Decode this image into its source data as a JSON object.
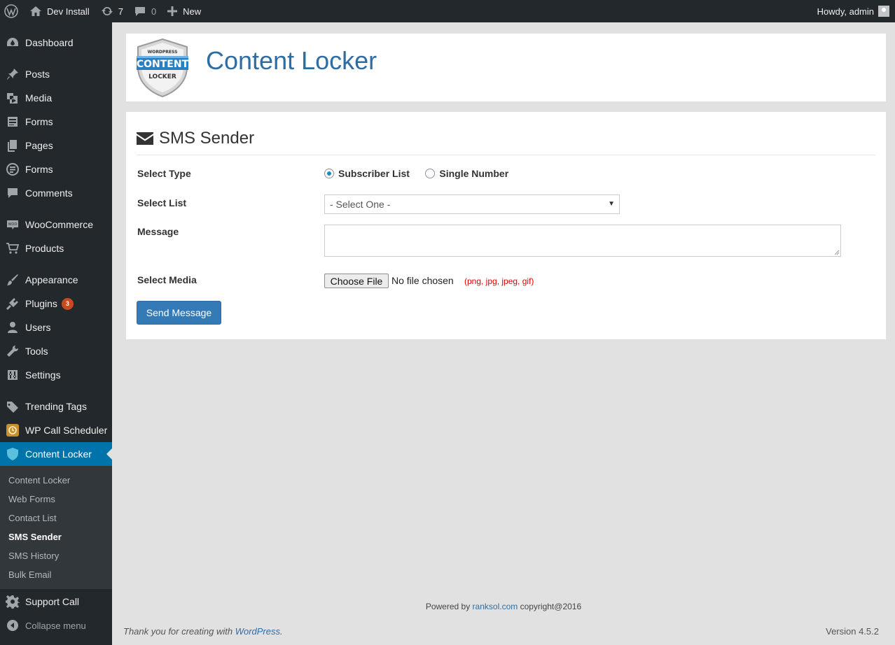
{
  "adminbar": {
    "site_name": "Dev Install",
    "updates_count": "7",
    "comments_count": "0",
    "new_label": "New",
    "greeting": "Howdy, admin"
  },
  "sidebar": {
    "items": [
      {
        "label": "Dashboard",
        "icon": "dashboard-icon"
      },
      {
        "label": "Posts",
        "icon": "pin-icon"
      },
      {
        "label": "Media",
        "icon": "media-icon"
      },
      {
        "label": "Forms",
        "icon": "forms-icon"
      },
      {
        "label": "Pages",
        "icon": "pages-icon"
      },
      {
        "label": "Forms",
        "icon": "forms-circle-icon"
      },
      {
        "label": "Comments",
        "icon": "comment-icon"
      },
      {
        "label": "WooCommerce",
        "icon": "woo-icon"
      },
      {
        "label": "Products",
        "icon": "cart-icon"
      },
      {
        "label": "Appearance",
        "icon": "brush-icon"
      },
      {
        "label": "Plugins",
        "icon": "plugin-icon",
        "badge": "3"
      },
      {
        "label": "Users",
        "icon": "user-icon"
      },
      {
        "label": "Tools",
        "icon": "wrench-icon"
      },
      {
        "label": "Settings",
        "icon": "settings-icon"
      },
      {
        "label": "Trending Tags",
        "icon": "tag-icon"
      },
      {
        "label": "WP Call Scheduler",
        "icon": "scheduler-icon"
      },
      {
        "label": "Content Locker",
        "icon": "shield-icon"
      }
    ],
    "submenu": [
      "Content Locker",
      "Web Forms",
      "Contact List",
      "SMS Sender",
      "SMS History",
      "Bulk Email"
    ],
    "support": "Support Call",
    "collapse": "Collapse menu"
  },
  "header": {
    "logo_top": "WORDPRESS",
    "logo_main": "CONTENT",
    "logo_bottom": "LOCKER",
    "title": "Content Locker"
  },
  "form": {
    "title": "SMS Sender",
    "type_label": "Select Type",
    "radio_subscriber": "Subscriber List",
    "radio_single": "Single Number",
    "list_label": "Select List",
    "list_value": "- Select One -",
    "message_label": "Message",
    "media_label": "Select Media",
    "choose_file": "Choose File",
    "file_status": "No file chosen",
    "file_hint": "(png, jpg, jpeg, gif)",
    "send_button": "Send Message"
  },
  "footer": {
    "powered_prefix": "Powered by",
    "powered_link": "ranksol.com",
    "powered_suffix": "copyright@2016",
    "thanks_prefix": "Thank you for creating with",
    "thanks_link": "WordPress",
    "version": "Version 4.5.2"
  },
  "colors": {
    "accent": "#0073aa",
    "button": "#337ab7",
    "hint": "#dd0000"
  }
}
